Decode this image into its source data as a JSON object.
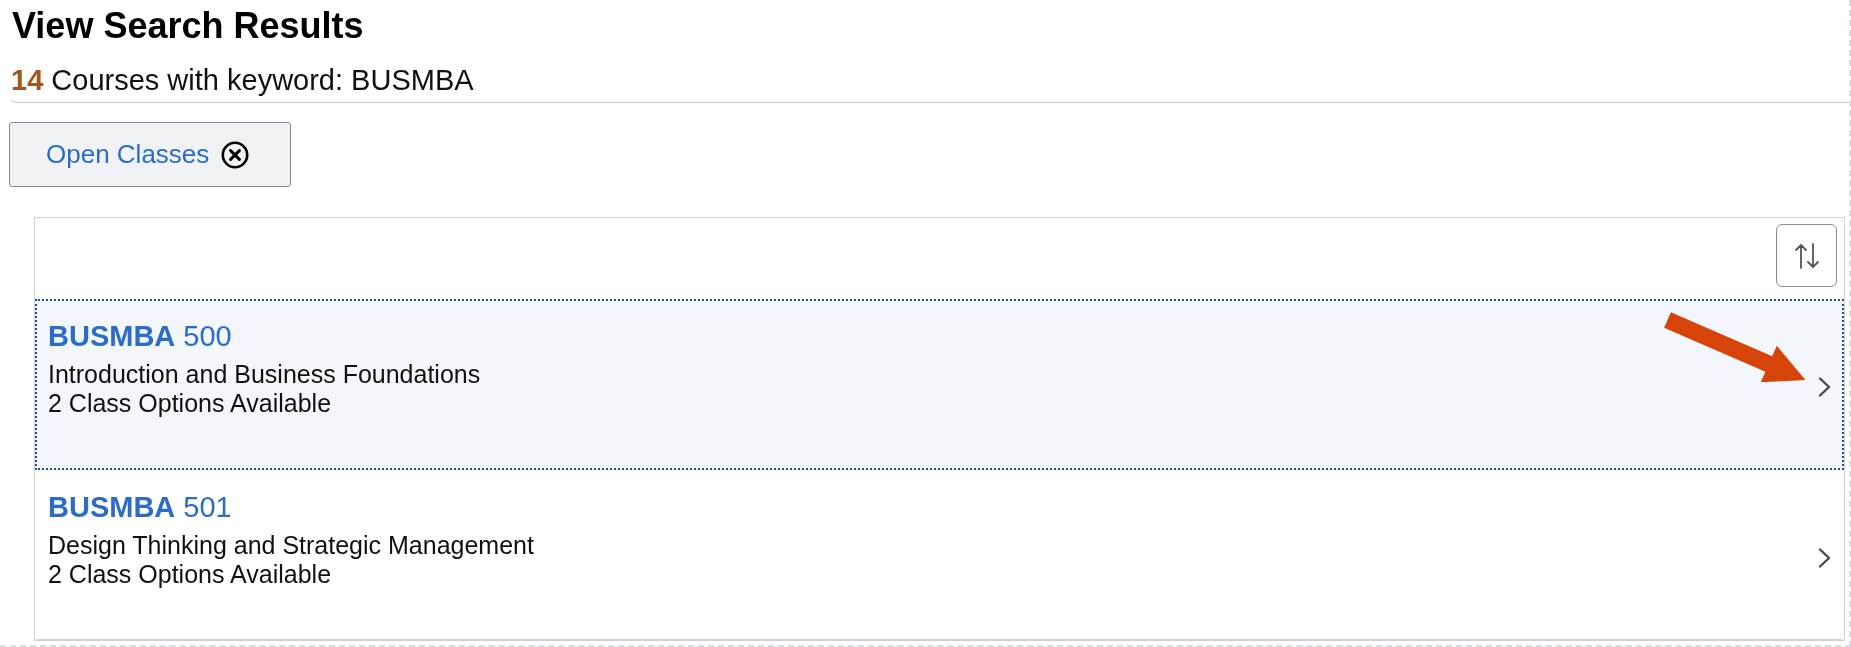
{
  "page": {
    "title": "View Search Results"
  },
  "summary": {
    "count": "14",
    "label": "Courses with keyword: BUSMBA"
  },
  "filters": [
    {
      "label": "Open Classes"
    }
  ],
  "results": {
    "courses": [
      {
        "subject": "BUSMBA",
        "number": "500",
        "title": "Introduction and Business Foundations",
        "options": "2 Class Options Available",
        "selected": true
      },
      {
        "subject": "BUSMBA",
        "number": "501",
        "title": "Design Thinking and Strategic Management",
        "options": "2 Class Options Available",
        "selected": false
      }
    ]
  }
}
